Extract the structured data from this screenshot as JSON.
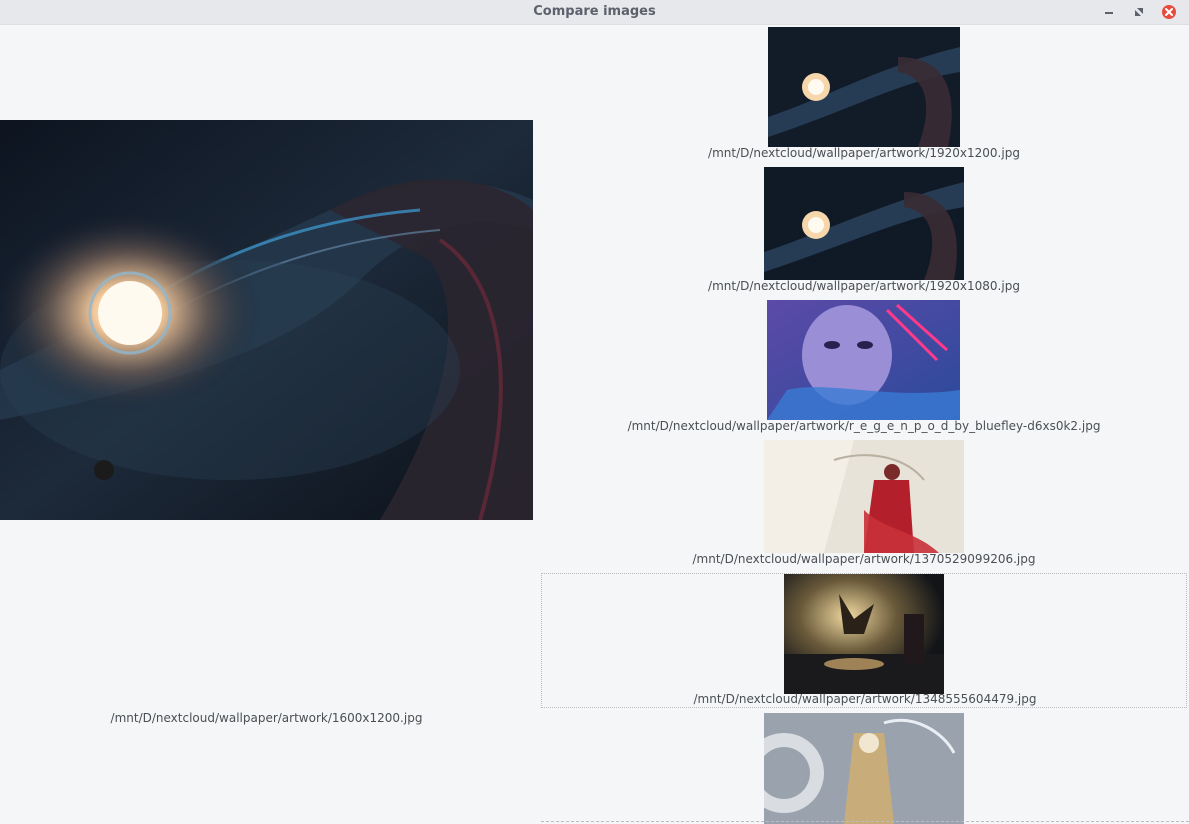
{
  "window": {
    "title": "Compare images"
  },
  "main": {
    "path": "/mnt/D/nextcloud/wallpaper/artwork/1600x1200.jpg"
  },
  "candidates": [
    {
      "path": "/mnt/D/nextcloud/wallpaper/artwork/1920x1200.jpg"
    },
    {
      "path": "/mnt/D/nextcloud/wallpaper/artwork/1920x1080.jpg"
    },
    {
      "path": "/mnt/D/nextcloud/wallpaper/artwork/r_e_g_e_n_p_o_d_by_bluefley-d6xs0k2.jpg"
    },
    {
      "path": "/mnt/D/nextcloud/wallpaper/artwork/1370529099206.jpg"
    },
    {
      "path": "/mnt/D/nextcloud/wallpaper/artwork/1348555604479.jpg",
      "selected": true
    },
    {
      "path": ""
    }
  ],
  "colors": {
    "close_button": "#e74c3c",
    "titlebar": "#e7e8eb",
    "background": "#f5f6f7"
  }
}
